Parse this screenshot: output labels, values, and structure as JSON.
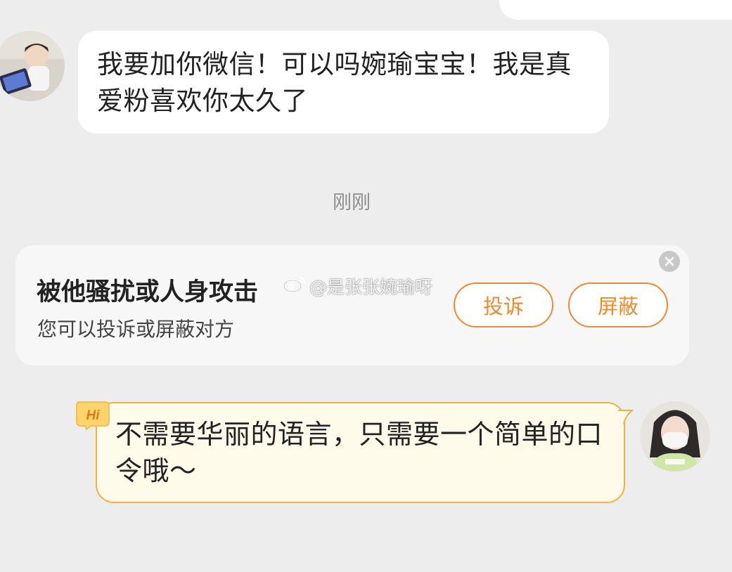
{
  "incoming_message": {
    "text": "我要加你微信！可以吗婉瑜宝宝！我是真爱粉喜欢你太久了"
  },
  "timestamp": "刚刚",
  "report_card": {
    "title": "被他骚扰或人身攻击",
    "subtitle": "您可以投诉或屏蔽对方",
    "complain_label": "投诉",
    "block_label": "屏蔽"
  },
  "watermark": {
    "text": "@是张张婉瑜呀"
  },
  "outgoing_message": {
    "text": "不需要华丽的语言，只需要一个简单的口令哦～",
    "badge": "Hi"
  },
  "icons": {
    "close": "close-icon",
    "weibo": "weibo-logo-icon",
    "hi_badge": "hi-badge-icon"
  },
  "colors": {
    "accent": "#f08a2b",
    "outgoing_bubble_bg": "#fffbea",
    "outgoing_bubble_border": "#f2b33c",
    "page_bg": "#ededed"
  }
}
